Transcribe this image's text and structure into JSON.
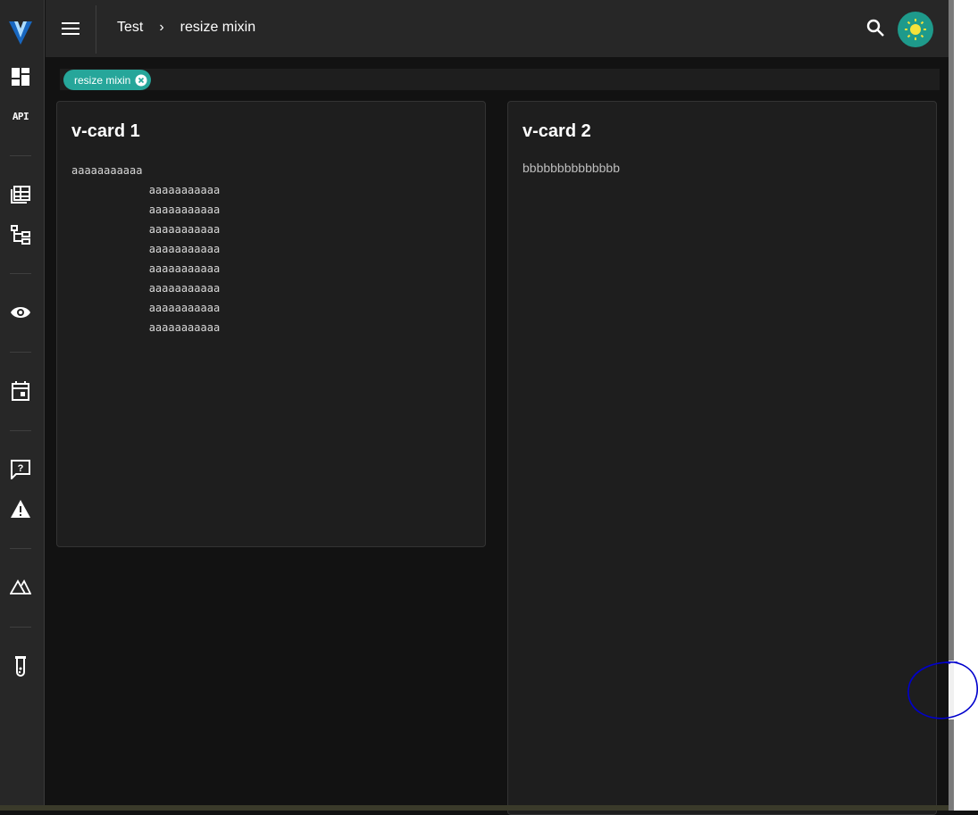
{
  "rail": {
    "items": [
      {
        "name": "vuetify-logo-icon"
      },
      {
        "name": "dashboard-icon"
      },
      {
        "name": "api-icon",
        "label": "API"
      },
      {
        "name": "table-icon"
      },
      {
        "name": "sitemap-icon"
      },
      {
        "name": "eye-icon"
      },
      {
        "name": "calendar-icon"
      },
      {
        "name": "question-message-icon"
      },
      {
        "name": "alert-icon"
      },
      {
        "name": "nuxt-icon"
      },
      {
        "name": "test-tube-icon"
      }
    ]
  },
  "appbar": {
    "breadcrumbs": [
      "Test",
      "resize mixin"
    ],
    "separator": "›"
  },
  "chips": [
    {
      "label": "resize mixin"
    }
  ],
  "cards": [
    {
      "title": "v-card 1",
      "text": "aaaaaaaaaaa\n            aaaaaaaaaaa\n            aaaaaaaaaaa\n            aaaaaaaaaaa\n            aaaaaaaaaaa\n            aaaaaaaaaaa\n            aaaaaaaaaaa\n            aaaaaaaaaaa\n            aaaaaaaaaaa"
    },
    {
      "title": "v-card 2",
      "text": "bbbbbbbbbbbbbb"
    }
  ],
  "colors": {
    "accent": "#26a69a",
    "theme_button": "#1e9a8b",
    "background": "#121212",
    "surface": "#1e1e1e",
    "annotation": "#0000cc"
  }
}
